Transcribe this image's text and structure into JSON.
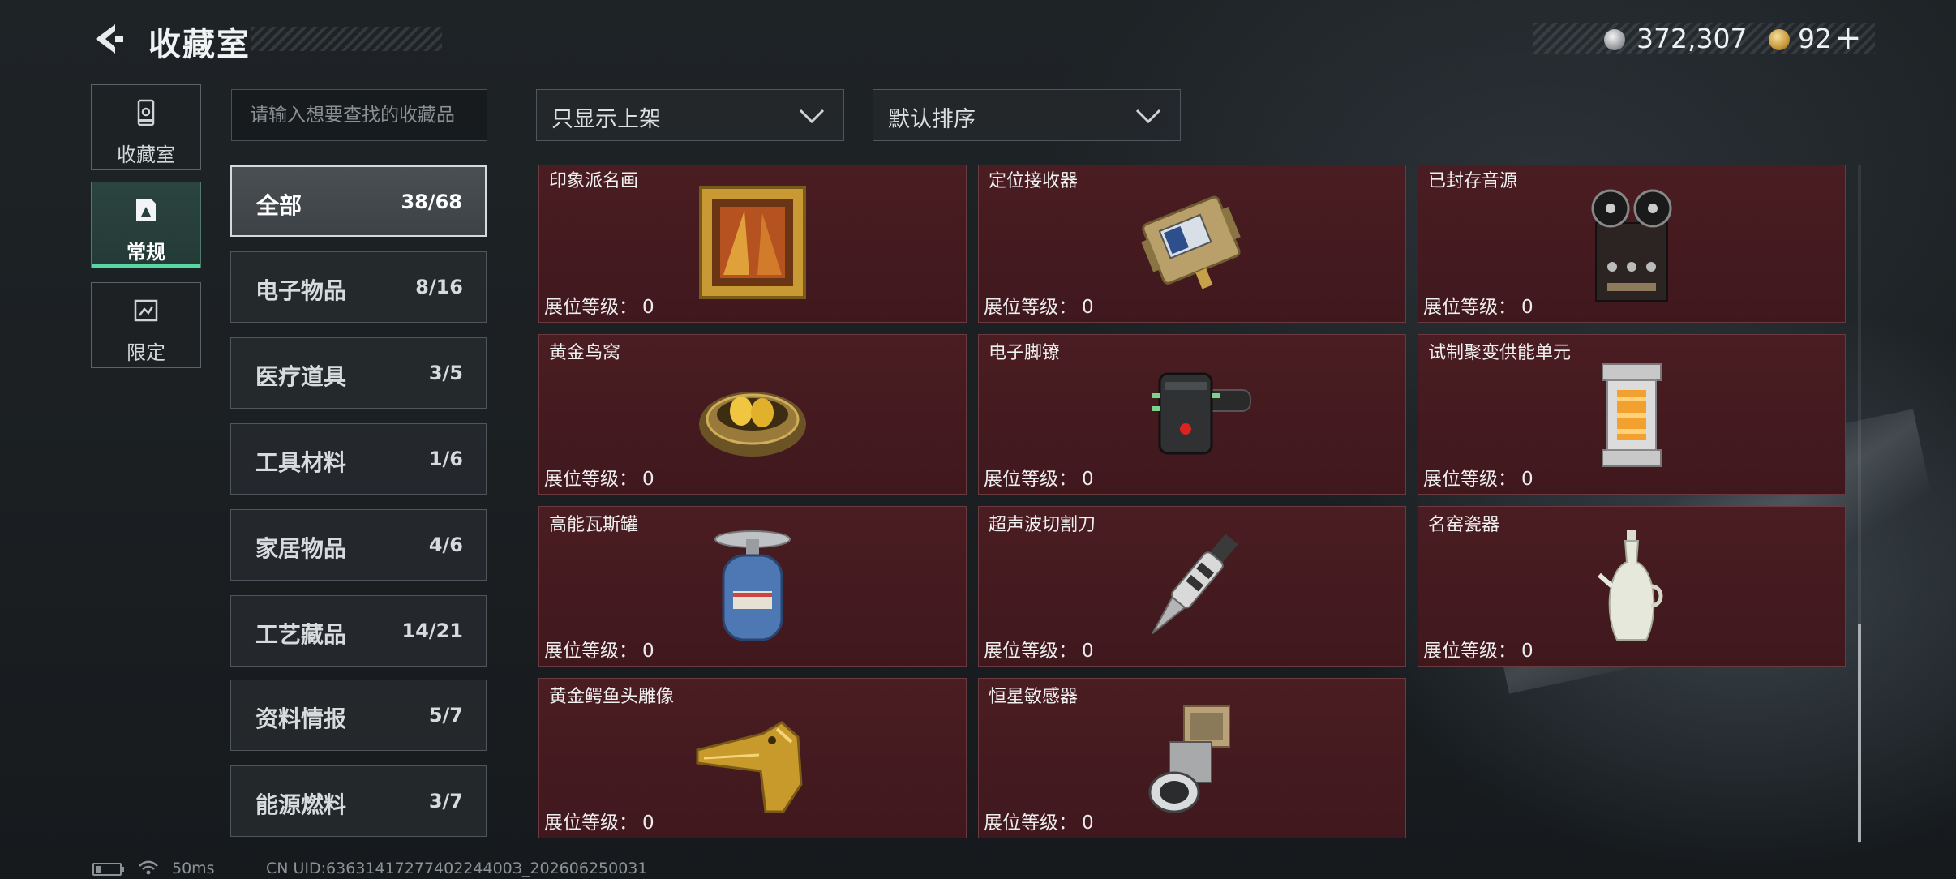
{
  "header": {
    "title": "收藏室",
    "currency_silver": "372,307",
    "currency_gold": "92",
    "plus_label": "+"
  },
  "nav": [
    {
      "label": "收藏室",
      "icon": "display-case-icon"
    },
    {
      "label": "常规",
      "icon": "regular-collection-icon",
      "active": true
    },
    {
      "label": "限定",
      "icon": "limited-collection-icon"
    }
  ],
  "search": {
    "placeholder": "请输入想要查找的收藏品",
    "value": ""
  },
  "filters": {
    "listing": "只显示上架",
    "sort": "默认排序"
  },
  "categories": [
    {
      "name": "全部",
      "count": "38/68",
      "active": true
    },
    {
      "name": "电子物品",
      "count": "8/16"
    },
    {
      "name": "医疗道具",
      "count": "3/5"
    },
    {
      "name": "工具材料",
      "count": "1/6"
    },
    {
      "name": "家居物品",
      "count": "4/6"
    },
    {
      "name": "工艺藏品",
      "count": "14/21"
    },
    {
      "name": "资料情报",
      "count": "5/7"
    },
    {
      "name": "能源燃料",
      "count": "3/7"
    }
  ],
  "level_label": "展位等级：",
  "items": [
    {
      "name": "印象派名画",
      "level": "0",
      "icon": "framed-painting-icon"
    },
    {
      "name": "定位接收器",
      "level": "0",
      "icon": "gps-receiver-icon"
    },
    {
      "name": "已封存音源",
      "level": "0",
      "icon": "reel-tape-recorder-icon"
    },
    {
      "name": "黄金鸟窝",
      "level": "0",
      "icon": "golden-nest-icon"
    },
    {
      "name": "电子脚镣",
      "level": "0",
      "icon": "electronic-ankle-monitor-icon"
    },
    {
      "name": "试制聚变供能单元",
      "level": "0",
      "icon": "fusion-power-unit-icon"
    },
    {
      "name": "高能瓦斯罐",
      "level": "0",
      "icon": "gas-canister-icon"
    },
    {
      "name": "超声波切割刀",
      "level": "0",
      "icon": "ultrasonic-cutter-icon"
    },
    {
      "name": "名窑瓷器",
      "level": "0",
      "icon": "porcelain-vase-icon"
    },
    {
      "name": "黄金鳄鱼头雕像",
      "level": "0",
      "icon": "golden-crocodile-head-icon"
    },
    {
      "name": "恒星敏感器",
      "level": "0",
      "icon": "star-sensor-icon"
    }
  ],
  "status": {
    "ping": "50ms",
    "uid": "CN UID:6363141727740224400З_202606250031"
  },
  "colors": {
    "accent": "#58d6a4",
    "card_bg": "#4a1d22",
    "card_border": "#6b3a3f"
  }
}
